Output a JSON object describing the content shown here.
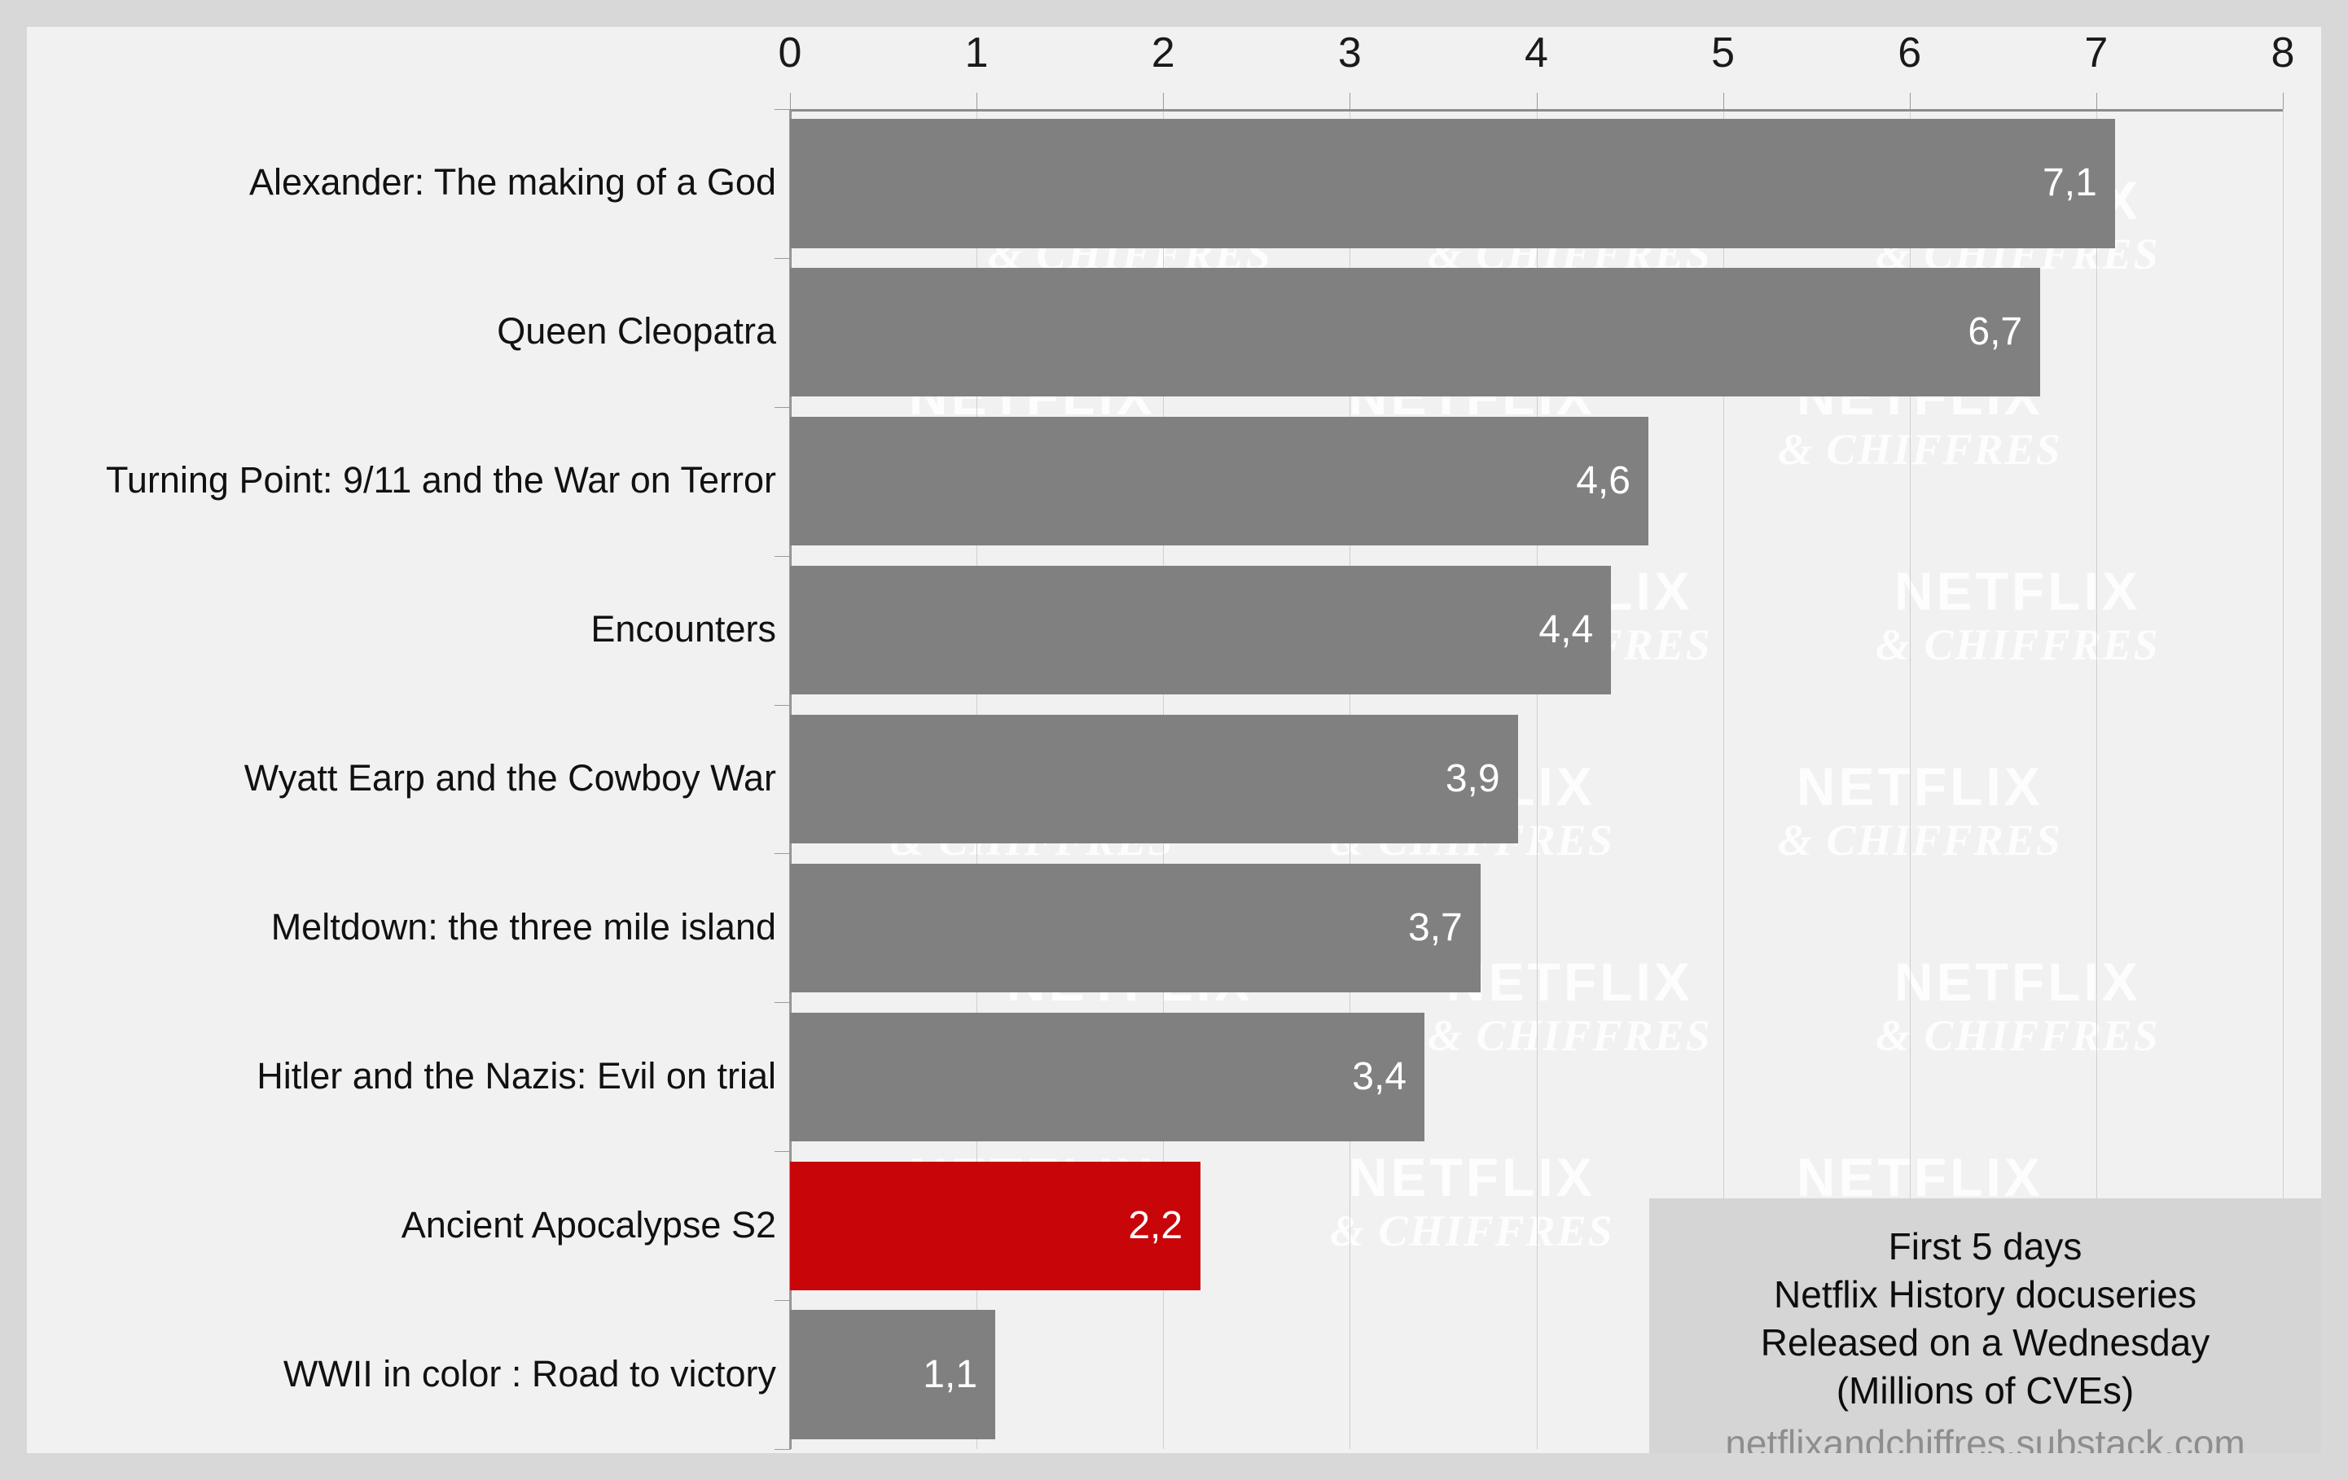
{
  "chart_data": {
    "type": "bar",
    "orientation": "horizontal",
    "title": "",
    "xlabel": "",
    "ylabel": "",
    "xlim": [
      0,
      8
    ],
    "xticks": [
      0,
      1,
      2,
      3,
      4,
      5,
      6,
      7,
      8
    ],
    "xtick_labels": [
      "0",
      "1",
      "2",
      "3",
      "4",
      "5",
      "6",
      "7",
      "8"
    ],
    "grid": true,
    "grid_axis": "x",
    "decimal_separator": ",",
    "categories": [
      "Alexander: The making of a God",
      "Queen Cleopatra",
      "Turning Point: 9/11 and the War on Terror",
      "Encounters",
      "Wyatt Earp and the Cowboy War",
      "Meltdown: the three mile island",
      "Hitler and the Nazis: Evil on trial",
      "Ancient Apocalypse S2",
      "WWII in color : Road to victory"
    ],
    "values": [
      7.1,
      6.7,
      4.6,
      4.4,
      3.9,
      3.7,
      3.4,
      2.2,
      1.1
    ],
    "value_labels": [
      "7,1",
      "6,7",
      "4,6",
      "4,4",
      "3,9",
      "3,7",
      "3,4",
      "2,2",
      "1,1"
    ],
    "bar_colors": [
      "#808080",
      "#808080",
      "#808080",
      "#808080",
      "#808080",
      "#808080",
      "#808080",
      "#c80509",
      "#808080"
    ],
    "highlight_index": 7,
    "highlight_color": "#c80509",
    "default_color": "#808080",
    "legend": []
  },
  "caption": {
    "lines": [
      "First 5 days",
      "Netflix History docuseries",
      "Released on a Wednesday",
      "(Millions of CVEs)"
    ],
    "source": "netflixandchiffres.substack.com"
  },
  "watermark": {
    "top": "NETFLIX",
    "bottom": "& CHIFFRES"
  },
  "colors": {
    "page_border": "#d8d8d8",
    "panel_background": "#f1f1f1",
    "bar_gray": "#808080",
    "bar_red": "#c80509",
    "axis": "#8c8c8c",
    "gridline": "#cfcfcf",
    "caption_background": "#d5d5d5",
    "value_label": "#ffffff",
    "category_label": "#111111",
    "source_text": "#8e8e8e"
  }
}
